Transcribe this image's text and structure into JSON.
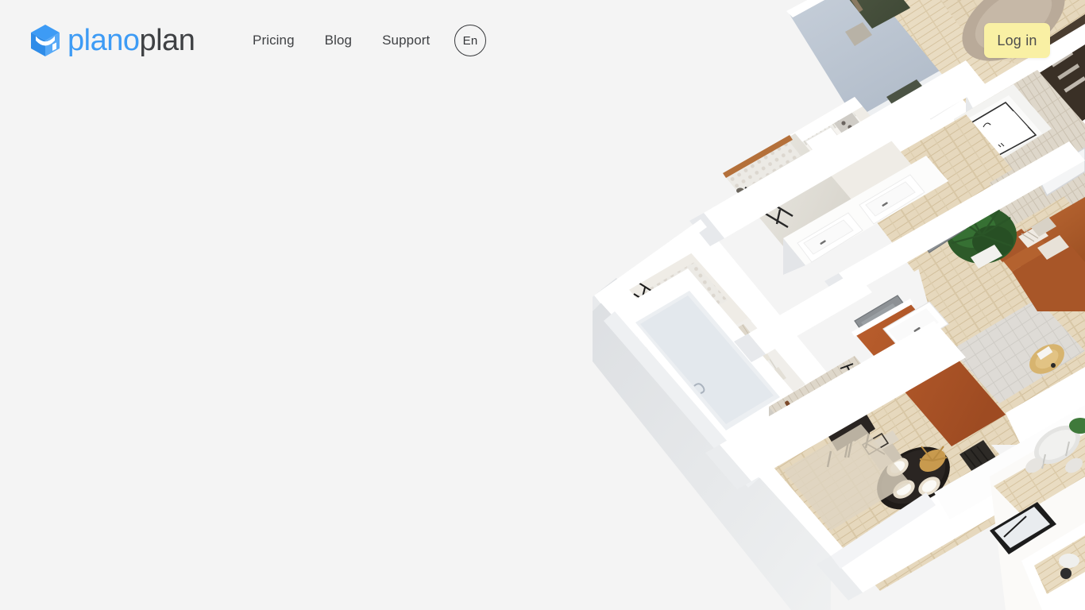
{
  "page": {
    "background_color": "#f4f4f4"
  },
  "header": {
    "brand": {
      "name": "planoplan",
      "name_part_blue": "plano",
      "name_part_dark": "plan",
      "mark_icon": "cube-logo-icon",
      "blue": "#3d9bf5",
      "dark": "#3f4144"
    },
    "nav": [
      {
        "label": "Pricing"
      },
      {
        "label": "Blog"
      },
      {
        "label": "Support"
      }
    ],
    "language": {
      "label": "En"
    },
    "login": {
      "label": "Log in",
      "background": "#f9f0a4",
      "text_color": "#4d4d4d"
    }
  },
  "hero": {
    "render_alt": "Isometric 3D apartment floor plan render",
    "palette": {
      "wall_white": "#ffffff",
      "wall_shadow": "#e9eaec",
      "floor_wood": "#e2d3b7",
      "floor_wood_dark": "#cbb994",
      "accent_orange": "#b4562a",
      "accent_green": "#4a5440",
      "sofa_brown": "#b4622f",
      "door_grey": "#8d9195",
      "rug_grey": "#d8d8d6",
      "tile_light": "#e8e6e2",
      "plant_green": "#2c5a2a",
      "balcony_blue": "#c5cdd8"
    }
  }
}
